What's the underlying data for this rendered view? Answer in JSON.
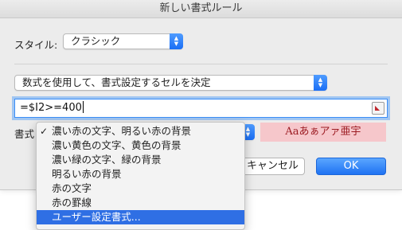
{
  "window": {
    "title": "新しい書式ルール"
  },
  "style_row": {
    "label": "スタイル:",
    "value": "クラシック"
  },
  "rule_type": {
    "value": "数式を使用して、書式設定するセルを決定"
  },
  "formula": {
    "value": "=$I2>=400"
  },
  "format_row": {
    "label": "書式"
  },
  "preview": {
    "text": "Aaあぁアァ亜宇"
  },
  "buttons": {
    "cancel": "キャンセル",
    "ok": "OK"
  },
  "menu": {
    "items": [
      {
        "label": "濃い赤の文字、明るい赤の背景",
        "checked": true,
        "check": "✓"
      },
      {
        "label": "濃い黄色の文字、黄色の背景"
      },
      {
        "label": "濃い緑の文字、緑の背景"
      },
      {
        "label": "明るい赤の背景"
      },
      {
        "label": "赤の文字"
      },
      {
        "label": "赤の罫線"
      },
      {
        "label": "ユーザー設定書式...",
        "highlighted": true
      }
    ]
  },
  "colors": {
    "accent": "#1f72f2",
    "preview_bg": "#f6c7cb",
    "preview_text": "#9c1b22",
    "menu_highlight": "#2f6fe4"
  }
}
